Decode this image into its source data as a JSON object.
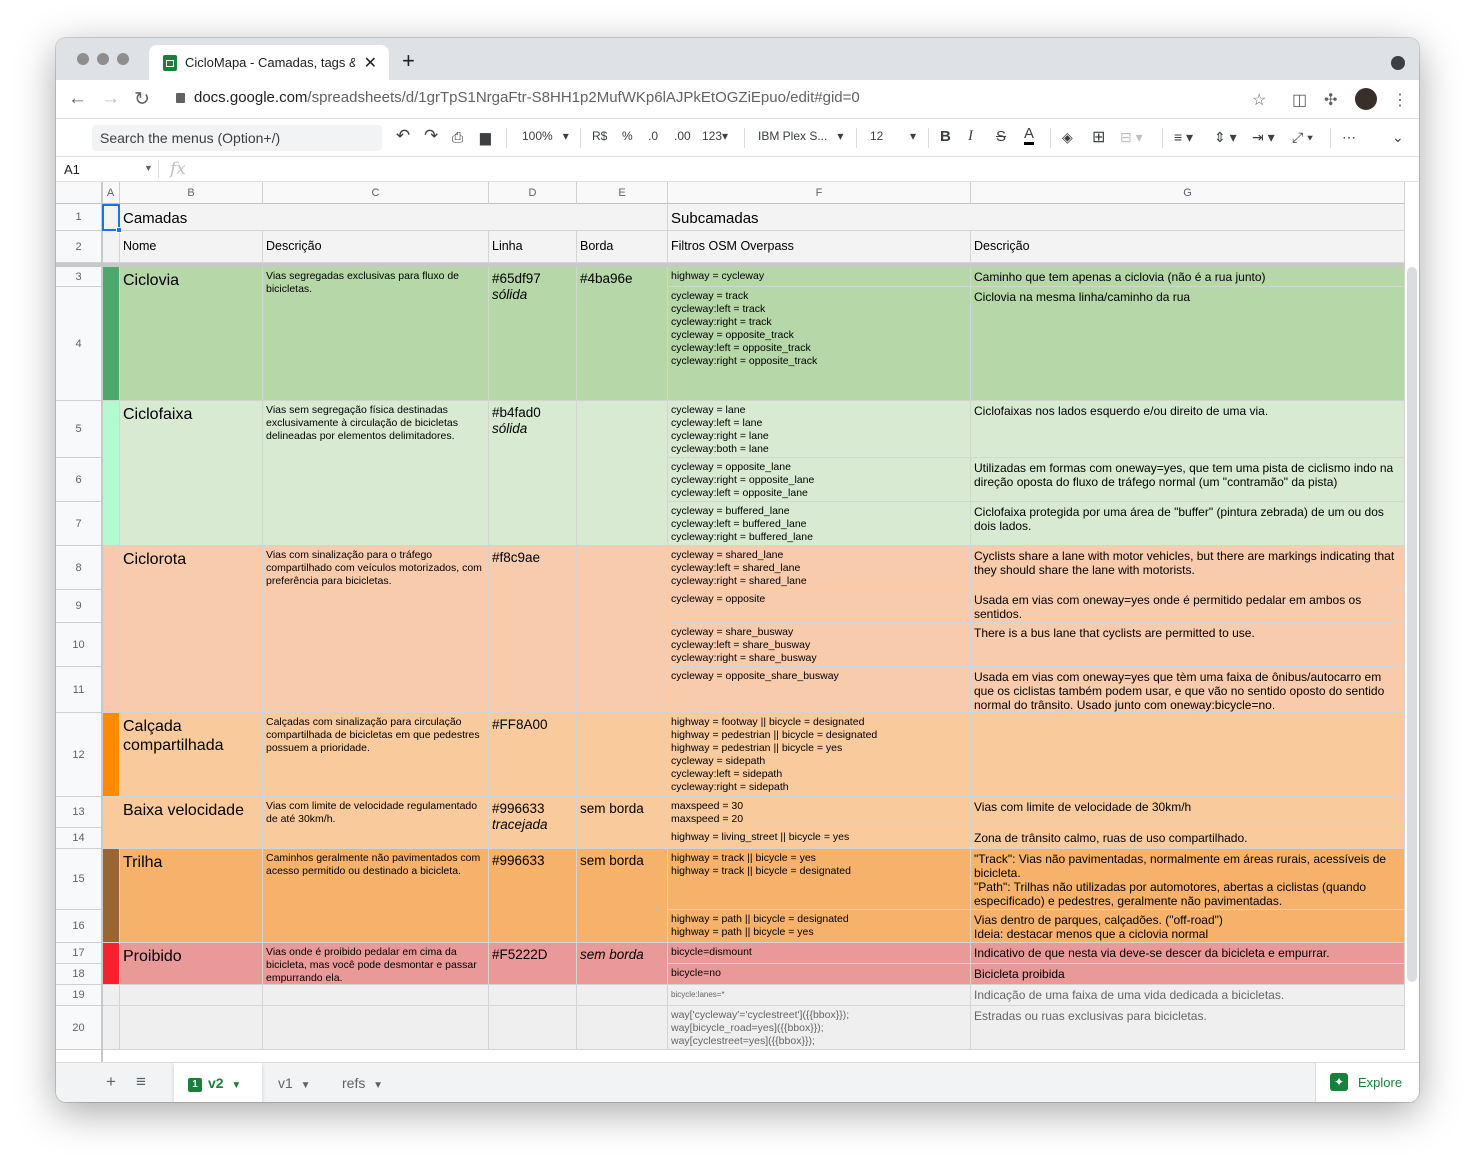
{
  "browser": {
    "tab_title": "CicloMapa - Camadas, tags & Overpass",
    "tab_close": "✕",
    "new_tab": "+",
    "url_host": "docs.google.com",
    "url_path": "/spreadsheets/d/1grTpS1NrgaFtr-S8HH1p2MufWKp6lAJPkEtOGZiEpuo/edit#gid=0"
  },
  "toolbar": {
    "search_placeholder": "Search the menus (Option+/)",
    "zoom": "100%",
    "currency": "R$",
    "percent": "%",
    "dec_decrease": ".0",
    "dec_increase": ".00",
    "format_more": "123",
    "font_name": "IBM Plex S...",
    "font_size": "12",
    "bold": "B",
    "italic": "I",
    "strike": "S",
    "text_color": "A",
    "more": "⋯"
  },
  "formula_bar": {
    "name_box": "A1",
    "fx": "fx"
  },
  "columns": [
    "A",
    "B",
    "C",
    "D",
    "E",
    "F",
    "G"
  ],
  "rows": {
    "r1": {
      "num": "1",
      "camadas": "Camadas",
      "subcamadas": "Subcamadas"
    },
    "r2": {
      "num": "2",
      "nome": "Nome",
      "descricao": "Descrição",
      "linha": "Linha",
      "borda": "Borda",
      "filtros": "Filtros OSM Overpass",
      "descricao2": "Descrição"
    },
    "ciclovia": {
      "name": "Ciclovia",
      "desc": "Vias segregadas exclusivas para fluxo de bicicletas.",
      "linha": "#65df97",
      "linha_style": "sólida",
      "borda": "#4ba96e",
      "r3": {
        "num": "3",
        "filter": "highway = cycleway",
        "desc": "Caminho que tem apenas a ciclovia (não é a rua junto)"
      },
      "r4": {
        "num": "4",
        "filter": "cycleway = track\ncycleway:left = track\ncycleway:right = track\ncycleway = opposite_track\ncycleway:left = opposite_track\ncycleway:right = opposite_track",
        "desc": "Ciclovia na mesma linha/caminho da rua"
      }
    },
    "ciclofaixa": {
      "name": "Ciclofaixa",
      "desc": "Vias sem segregação física destinadas exclusivamente à circulação de bicicletas delineadas por elementos delimitadores.",
      "linha": "#b4fad0",
      "linha_style": "sólida",
      "r5": {
        "num": "5",
        "filter": "cycleway = lane\ncycleway:left = lane\ncycleway:right = lane\ncycleway:both = lane",
        "desc": "Ciclofaixas nos lados esquerdo e/ou direito de uma via."
      },
      "r6": {
        "num": "6",
        "filter": "cycleway = opposite_lane\ncycleway:right = opposite_lane\ncycleway:left = opposite_lane",
        "desc": "Utilizadas em formas com oneway=yes, que tem uma pista de ciclismo indo na direção oposta do fluxo de tráfego normal (um \"contramão\" da pista)"
      },
      "r7": {
        "num": "7",
        "filter": "cycleway = buffered_lane\ncycleway:left = buffered_lane\ncycleway:right = buffered_lane",
        "desc": "Ciclofaixa protegida por uma área de \"buffer\" (pintura zebrada) de um ou dos dois lados."
      }
    },
    "ciclorota": {
      "name": "Ciclorota",
      "desc": "Vias com sinalização para o tráfego compartilhado com veículos motorizados, com preferência para bicicletas.",
      "linha": "#f8c9ae",
      "r8": {
        "num": "8",
        "filter": "cycleway = shared_lane\ncycleway:left = shared_lane\ncycleway:right = shared_lane",
        "desc": "Cyclists share a lane with motor vehicles, but there are markings indicating that they should share the lane with motorists."
      },
      "r9": {
        "num": "9",
        "filter": "cycleway = opposite",
        "desc": "Usada em vias com oneway=yes onde é permitido pedalar em ambos os sentidos."
      },
      "r10": {
        "num": "10",
        "filter": "cycleway = share_busway\ncycleway:left = share_busway\ncycleway:right = share_busway",
        "desc": "There is a bus lane that cyclists are permitted to use."
      },
      "r11": {
        "num": "11",
        "filter": "cycleway = opposite_share_busway",
        "desc": "Usada em vias com oneway=yes que tèm uma faixa de ônibus/autocarro em que os ciclistas também podem usar, e que vão no sentido oposto do sentido normal do trânsito. Usado junto com oneway:bicycle=no."
      }
    },
    "calcada": {
      "num": "12",
      "name": "Calçada compartilhada",
      "desc": "Calçadas com sinalização para circulação compartilhada de bicicletas em que pedestres possuem a prioridade.",
      "linha": "#FF8A00",
      "filter": "highway = footway || bicycle = designated\nhighway = pedestrian || bicycle = designated\nhighway = pedestrian || bicycle = yes\ncycleway = sidepath\ncycleway:left = sidepath\ncycleway:right = sidepath",
      "fdesc": ""
    },
    "baixa": {
      "name": "Baixa velocidade",
      "desc": "Vias com limite de velocidade regulamentado de até 30km/h.",
      "linha": "#996633",
      "linha_style": "tracejada",
      "borda": "sem borda",
      "r13": {
        "num": "13",
        "filter": "maxspeed = 30\nmaxspeed = 20",
        "desc": "Vias com limite de velocidade de 30km/h"
      },
      "r14": {
        "num": "14",
        "filter": "highway = living_street || bicycle = yes",
        "desc": "Zona de trânsito calmo, ruas de uso compartilhado."
      }
    },
    "trilha": {
      "name": "Trilha",
      "desc": "Caminhos geralmente não pavimentados com acesso permitido ou destinado a bicicleta.",
      "linha": "#996633",
      "borda": "sem borda",
      "r15": {
        "num": "15",
        "filter": "highway = track || bicycle = yes\nhighway = track || bicycle = designated",
        "desc": "\"Track\": Vias não pavimentadas, normalmente em áreas rurais, acessíveis de bicicleta.\n\"Path\": Trilhas não utilizadas por automotores, abertas a ciclistas (quando especificado) e pedestres, geralmente não pavimentadas."
      },
      "r16": {
        "num": "16",
        "filter": "highway = path || bicycle = designated\nhighway = path || bicycle = yes",
        "desc": "Vias dentro de parques, calçadões. (\"off-road\")\nIdeia: destacar menos que a ciclovia normal"
      }
    },
    "proibido": {
      "name": "Proibido",
      "desc": "Vias onde é proibido pedalar em cima da bicicleta, mas você pode desmontar e passar empurrando ela.",
      "linha": "#F5222D",
      "borda": "sem borda",
      "r17": {
        "num": "17",
        "filter": "bicycle=dismount",
        "desc": "Indicativo de que nesta via deve-se descer da bicicleta e empurrar."
      },
      "r18": {
        "num": "18",
        "filter": "bicycle=no",
        "desc": "Bicicleta proibida"
      }
    },
    "r19": {
      "num": "19",
      "filter": "bicycle:lanes=*",
      "desc": "Indicação de uma faixa de uma vida dedicada a bicicletas."
    },
    "r20": {
      "num": "20",
      "filter": "way['cycleway'='cyclestreet']({{bbox}});\nway[bicycle_road=yes]({{bbox}});\nway[cyclestreet=yes]({{bbox}});",
      "desc": "Estradas ou ruas exclusivas para bicicletas."
    }
  },
  "sheets": {
    "add": "+",
    "list": "≡",
    "tabs": [
      {
        "num": "1",
        "label": "v2"
      },
      {
        "label": "v1"
      },
      {
        "label": "refs"
      }
    ],
    "explore": "Explore"
  },
  "colors": {
    "ciclovia_band": "#4ba96e",
    "ciclovia_bg": "#b6d7a8",
    "ciclofaixa_band": "#b4fad0",
    "ciclofaixa_bg": "#d9ead3",
    "ciclorota_band": "#f8c9ae",
    "ciclorota_bg": "#f8cbad",
    "calcada_band": "#ff8a00",
    "calcada_bg": "#f9cb9c",
    "trilha_band": "#996633",
    "trilha_bg": "#f6b26b",
    "proibido_band": "#f5222d",
    "proibido_bg": "#ea9999",
    "accent_green": "#188038",
    "selection": "#1a73e8"
  }
}
